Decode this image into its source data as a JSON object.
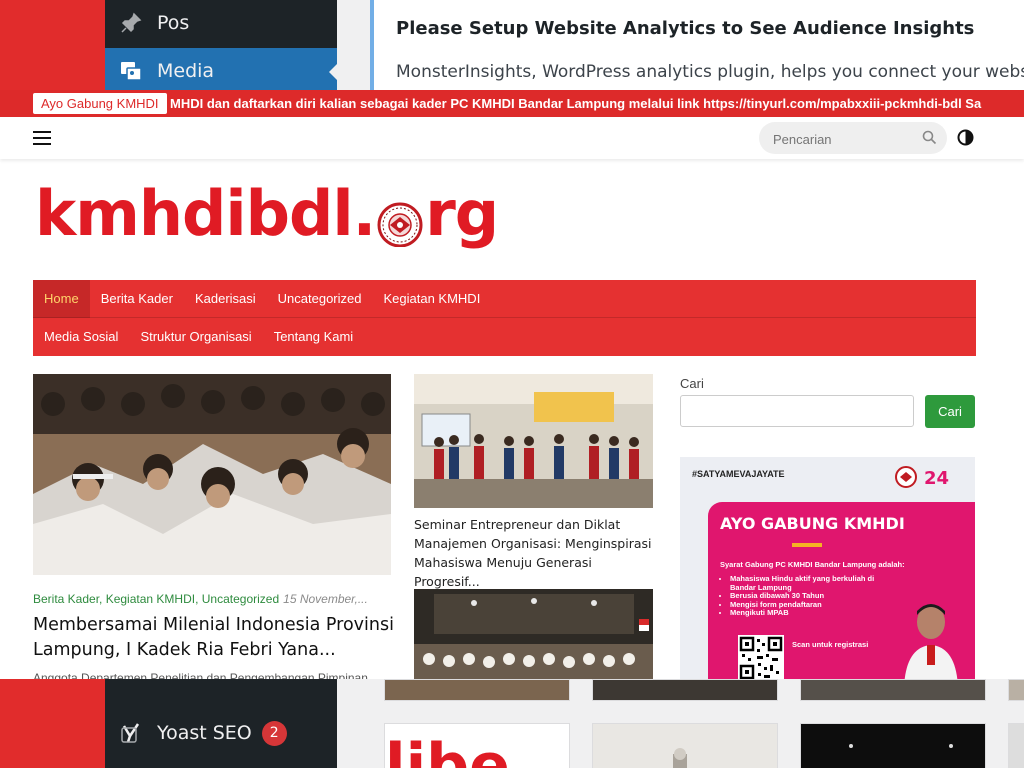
{
  "wp_admin": {
    "menu": [
      {
        "label": "Pos",
        "icon": "pin-icon",
        "active": false
      },
      {
        "label": "Media",
        "icon": "media-icon",
        "active": true
      }
    ],
    "notice": {
      "title": "Please Setup Website Analytics to See Audience Insights",
      "body": "MonsterInsights, WordPress analytics plugin, helps you connect your website"
    },
    "yoast": {
      "label": "Yoast SEO",
      "badge": "2"
    }
  },
  "ticker": {
    "badge": "Ayo Gabung KMHDI",
    "text": "MHDI dan daftarkan diri kalian sebagai kader PC KMHDI Bandar Lampung melalui link https://tinyurl.com/mpabxxiii-pckmhdi-bdl Sa"
  },
  "header": {
    "search_placeholder": "Pencarian"
  },
  "logo": {
    "left": "kmhdibdl.",
    "right": "rg"
  },
  "nav": {
    "row1": [
      "Home",
      "Berita Kader",
      "Kaderisasi",
      "Uncategorized",
      "Kegiatan KMHDI"
    ],
    "row2": [
      "Media Sosial",
      "Struktur Organisasi",
      "Tentang Kami"
    ],
    "active": "Home"
  },
  "posts": {
    "featured": {
      "categories": "Berita Kader, Kegiatan KMHDI, Uncategorized",
      "date": "15 November,...",
      "title": "Membersamai Milenial Indonesia Provinsi Lampung, I Kadek Ria Febri Yana...",
      "excerpt": "Anggota Departemen Penelitian dan Pengembangan Pimpinan"
    },
    "second": {
      "title": "Seminar Entrepreneur dan Diklat Manajemen Organisasi: Menginspirasi Mahasiswa Menuju Generasi Progresif..."
    }
  },
  "sidebar": {
    "search_label": "Cari",
    "search_button": "Cari",
    "poster": {
      "hashtag": "#SATYAMEVAJAYATE",
      "heading": "AYO GABUNG KMHDI",
      "subheading": "Syarat Gabung PC KMHDI Bandar Lampung adalah:",
      "requirements": [
        "Mahasiswa Hindu aktif yang berkuliah di Bandar Lampung",
        "Berusia dibawah 30 Tahun",
        "Mengisi form pendaftaran",
        "Mengikuti MPAB"
      ],
      "scan": "Scan untuk registrasi"
    }
  },
  "colors": {
    "brand_red": "#e01b24",
    "nav_red": "#e53131",
    "category_green": "#2e8b3e",
    "button_green": "#2e9a3c",
    "wp_dark": "#1d2327",
    "wp_blue": "#2271b1"
  }
}
